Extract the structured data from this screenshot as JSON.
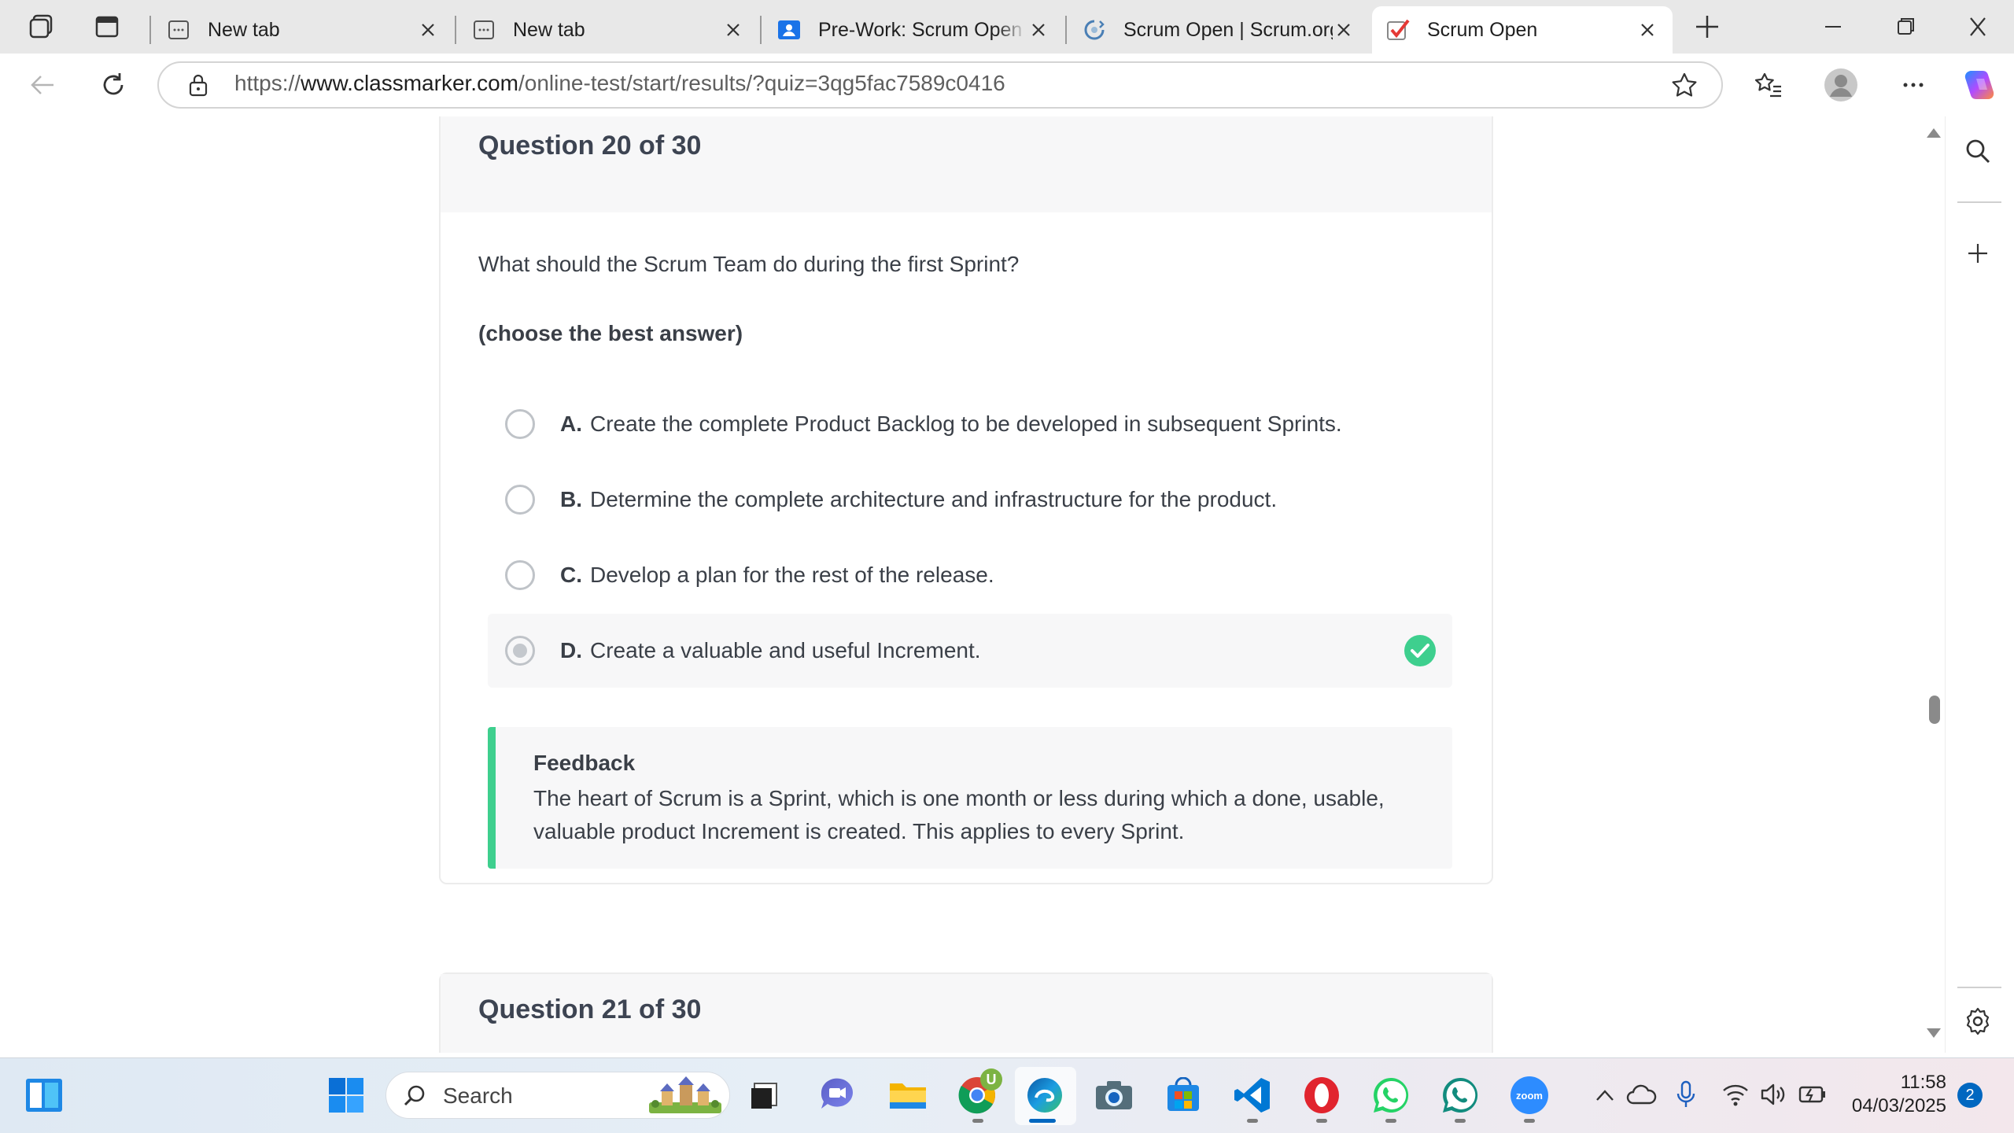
{
  "browser": {
    "tabs": [
      {
        "title": "New tab",
        "favicon": "new-tab-icon",
        "active": false
      },
      {
        "title": "New tab",
        "favicon": "new-tab-icon",
        "active": false
      },
      {
        "title": "Pre-Work: Scrum Open Assessment",
        "favicon": "classroom-icon",
        "active": false
      },
      {
        "title": "Scrum Open | Scrum.org",
        "favicon": "scrum-org-icon",
        "active": false
      },
      {
        "title": "Scrum Open",
        "favicon": "classmarker-check-icon",
        "active": true
      }
    ],
    "url_prefix": "https://",
    "url_domain": "www.classmarker.com",
    "url_path": "/online-test/start/results/?quiz=3qg5fac7589c0416"
  },
  "question": {
    "title": "Question 20 of 30",
    "text": "What should the Scrum Team do during the first Sprint?",
    "instruction": "(choose the best answer)",
    "options": [
      {
        "letter": "A.",
        "text": "Create the complete Product Backlog to be developed in subsequent Sprints.",
        "selected": false
      },
      {
        "letter": "B.",
        "text": "Determine the complete architecture and infrastructure for the product.",
        "selected": false
      },
      {
        "letter": "C.",
        "text": "Develop a plan for the rest of the release.",
        "selected": false
      },
      {
        "letter": "D.",
        "text": "Create a valuable and useful Increment.",
        "selected": true,
        "correct": true
      }
    ],
    "feedback_heading": "Feedback",
    "feedback_text": "The heart of Scrum is a Sprint, which is one month or less during which a done, usable, valuable product Increment is created. This applies to every Sprint."
  },
  "next_question": {
    "title": "Question 21 of 30"
  },
  "taskbar": {
    "search_placeholder": "Search",
    "time": "11:58",
    "date": "04/03/2025",
    "notification_count": "2",
    "chrome_badge": "U",
    "zoom_label": "zoom"
  },
  "colors": {
    "correct_green": "#3ecf8e",
    "accent_blue": "#0067c0"
  }
}
